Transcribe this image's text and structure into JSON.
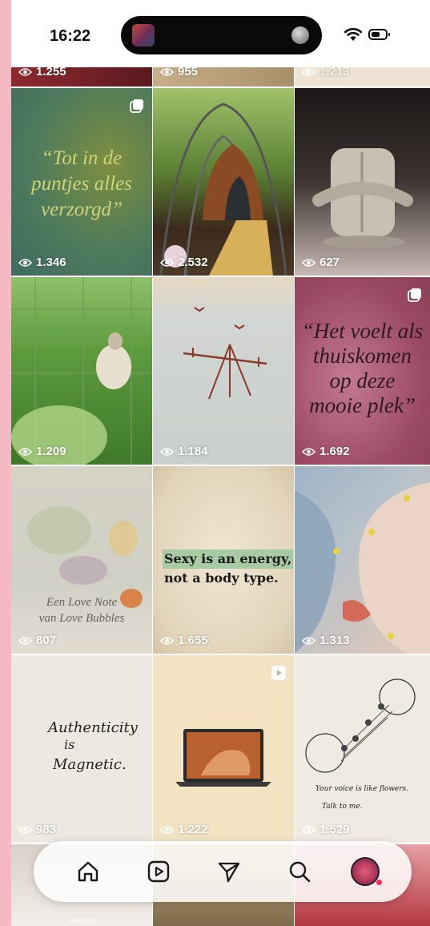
{
  "status_bar": {
    "time": "16:22"
  },
  "grid": {
    "top_row": [
      {
        "views": "1.255"
      },
      {
        "views": "955"
      },
      {
        "views": "1.213"
      }
    ],
    "posts": [
      {
        "views": "1.346",
        "quote": "“Tot in de puntjes alles verzorgd”"
      },
      {
        "views": "2.532"
      },
      {
        "views": "627"
      },
      {
        "views": "1.209"
      },
      {
        "views": "1.184"
      },
      {
        "views": "1.692",
        "quote": "“Het voelt als thuiskomen op deze mooie plek”"
      },
      {
        "views": "807",
        "caption_line1": "Een Love Note",
        "caption_line2": "van Love Bubbles"
      },
      {
        "views": "1.655",
        "line1": "Sexy is an energy,",
        "line2": "not a body type."
      },
      {
        "views": "1.313"
      },
      {
        "views": "983",
        "hand_line1": "Authenticity",
        "hand_line2": "is",
        "hand_line3": "Magnetic."
      },
      {
        "views": "1.222"
      },
      {
        "views": "1.529",
        "hand_line1": "Your voice is like flowers.",
        "hand_line2": "Talk to me."
      }
    ],
    "bottom_partial": {
      "label": "Valentijn"
    }
  },
  "colors": {
    "accent": "#ff2b4f",
    "page_bg": "#f4b9c3"
  }
}
